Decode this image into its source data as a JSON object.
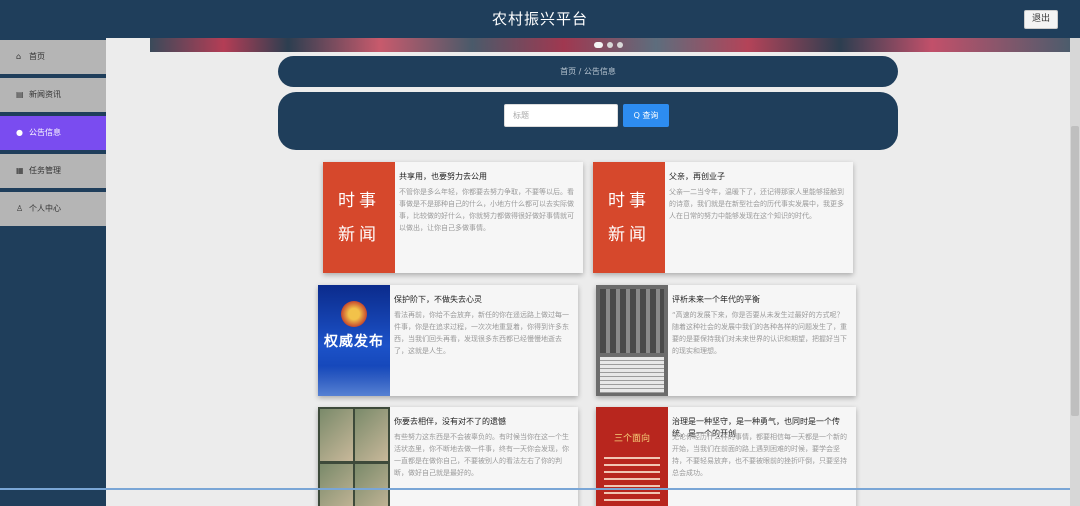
{
  "header": {
    "title": "农村振兴平台",
    "logout_label": "退出"
  },
  "sidebar": {
    "items": [
      {
        "icon": "home-icon",
        "glyph": "⌂",
        "label": "首页",
        "active": false
      },
      {
        "icon": "news-icon",
        "glyph": "▤",
        "label": "新闻资讯",
        "active": false
      },
      {
        "icon": "notice-icon",
        "glyph": "●",
        "label": "公告信息",
        "active": true
      },
      {
        "icon": "manage-icon",
        "glyph": "▦",
        "label": "任务管理",
        "active": false
      },
      {
        "icon": "user-icon",
        "glyph": "♙",
        "label": "个人中心",
        "active": false
      }
    ]
  },
  "breadcrumb": {
    "text": "首页 / 公告信息"
  },
  "search": {
    "placeholder": "标题",
    "button_label": "Q 查询"
  },
  "cards": [
    {
      "title": "共享用，也要努力去公用",
      "text": "不管你是多么年轻，你都要去努力争取，不要等以后。看事做是不是那种自己的什么，小地方什么都可以去实际做事，比较做的好什么，你就努力都做得很好做好事情就可以做出，让你自己多做事情。",
      "thumb_text": [
        "时事",
        "新闻"
      ]
    },
    {
      "title": "父亲，再创业子",
      "text": "父亲一二当令年，温暖下了，还记得那家人里能够接触到的诗意，我们就是在新型社会的历代事实发展中，我更多人在日常的努力中能够发现在这个知识的时代。",
      "thumb_text": [
        "时事",
        "新闻"
      ]
    },
    {
      "title": "保护阶下，不做失去心灵",
      "text": "看法再前，你给不会放弃，新任的你在遥远路上做过每一件事，你是在追求过程，一次次地重复着，你得到许多东西，当我们回头再看，发现很多东西都已经慢慢地逝去了，这就是人生。",
      "thumb_text": [
        "权威发布"
      ]
    },
    {
      "title": "评析未来一个年代的平衡",
      "text": "“高速的发展下来，你是否要从未发生过最好的方式呢？随着这种社会的发展中我们的各种各样的问题发生了，重要的是要保持我们对未来世界的认识和期望，把握好当下的现实和理想。",
      "thumb_text": []
    },
    {
      "title": "你要去相伴，没有对不了的遗憾",
      "text": "有些努力这东西是不会被辜负的。有时候当你在这一个生活状态里，你不断地去做一件事，终有一天你会发现，你一直都是在做你自己，不要被别人的看法左右了你的判断，做好自己就是最好的。",
      "thumb_text": []
    },
    {
      "title": "治理是一种坚守，是一种勇气，也同时是一个传统，是一个的开创",
      "text": "无论你经历什么样的事情，都要相信每一天都是一个新的开始，当我们在前面的路上遇到困难的时候，要学会坚持，不要轻易放弃，也不要被眼前的挫折吓倒，只要坚持总会成功。",
      "thumb_text": [
        "三个面向"
      ]
    }
  ]
}
